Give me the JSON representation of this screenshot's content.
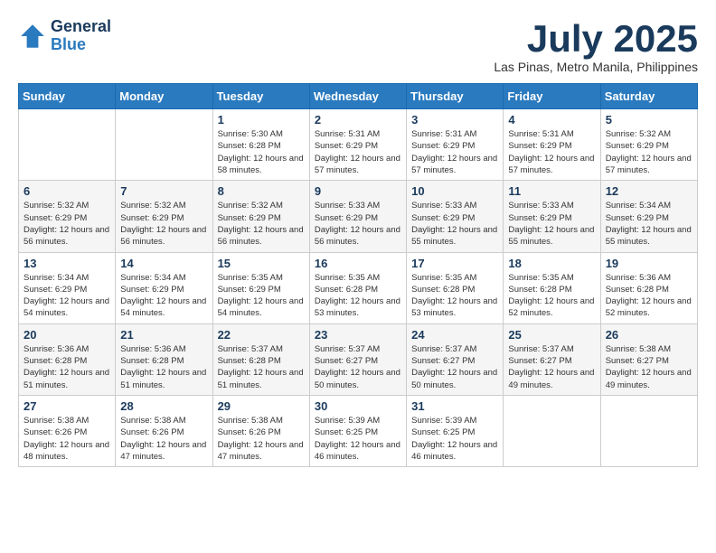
{
  "header": {
    "logo_line1": "General",
    "logo_line2": "Blue",
    "month_title": "July 2025",
    "location": "Las Pinas, Metro Manila, Philippines"
  },
  "days_of_week": [
    "Sunday",
    "Monday",
    "Tuesday",
    "Wednesday",
    "Thursday",
    "Friday",
    "Saturday"
  ],
  "weeks": [
    [
      {
        "day": "",
        "info": ""
      },
      {
        "day": "",
        "info": ""
      },
      {
        "day": "1",
        "info": "Sunrise: 5:30 AM\nSunset: 6:28 PM\nDaylight: 12 hours and 58 minutes."
      },
      {
        "day": "2",
        "info": "Sunrise: 5:31 AM\nSunset: 6:29 PM\nDaylight: 12 hours and 57 minutes."
      },
      {
        "day": "3",
        "info": "Sunrise: 5:31 AM\nSunset: 6:29 PM\nDaylight: 12 hours and 57 minutes."
      },
      {
        "day": "4",
        "info": "Sunrise: 5:31 AM\nSunset: 6:29 PM\nDaylight: 12 hours and 57 minutes."
      },
      {
        "day": "5",
        "info": "Sunrise: 5:32 AM\nSunset: 6:29 PM\nDaylight: 12 hours and 57 minutes."
      }
    ],
    [
      {
        "day": "6",
        "info": "Sunrise: 5:32 AM\nSunset: 6:29 PM\nDaylight: 12 hours and 56 minutes."
      },
      {
        "day": "7",
        "info": "Sunrise: 5:32 AM\nSunset: 6:29 PM\nDaylight: 12 hours and 56 minutes."
      },
      {
        "day": "8",
        "info": "Sunrise: 5:32 AM\nSunset: 6:29 PM\nDaylight: 12 hours and 56 minutes."
      },
      {
        "day": "9",
        "info": "Sunrise: 5:33 AM\nSunset: 6:29 PM\nDaylight: 12 hours and 56 minutes."
      },
      {
        "day": "10",
        "info": "Sunrise: 5:33 AM\nSunset: 6:29 PM\nDaylight: 12 hours and 55 minutes."
      },
      {
        "day": "11",
        "info": "Sunrise: 5:33 AM\nSunset: 6:29 PM\nDaylight: 12 hours and 55 minutes."
      },
      {
        "day": "12",
        "info": "Sunrise: 5:34 AM\nSunset: 6:29 PM\nDaylight: 12 hours and 55 minutes."
      }
    ],
    [
      {
        "day": "13",
        "info": "Sunrise: 5:34 AM\nSunset: 6:29 PM\nDaylight: 12 hours and 54 minutes."
      },
      {
        "day": "14",
        "info": "Sunrise: 5:34 AM\nSunset: 6:29 PM\nDaylight: 12 hours and 54 minutes."
      },
      {
        "day": "15",
        "info": "Sunrise: 5:35 AM\nSunset: 6:29 PM\nDaylight: 12 hours and 54 minutes."
      },
      {
        "day": "16",
        "info": "Sunrise: 5:35 AM\nSunset: 6:28 PM\nDaylight: 12 hours and 53 minutes."
      },
      {
        "day": "17",
        "info": "Sunrise: 5:35 AM\nSunset: 6:28 PM\nDaylight: 12 hours and 53 minutes."
      },
      {
        "day": "18",
        "info": "Sunrise: 5:35 AM\nSunset: 6:28 PM\nDaylight: 12 hours and 52 minutes."
      },
      {
        "day": "19",
        "info": "Sunrise: 5:36 AM\nSunset: 6:28 PM\nDaylight: 12 hours and 52 minutes."
      }
    ],
    [
      {
        "day": "20",
        "info": "Sunrise: 5:36 AM\nSunset: 6:28 PM\nDaylight: 12 hours and 51 minutes."
      },
      {
        "day": "21",
        "info": "Sunrise: 5:36 AM\nSunset: 6:28 PM\nDaylight: 12 hours and 51 minutes."
      },
      {
        "day": "22",
        "info": "Sunrise: 5:37 AM\nSunset: 6:28 PM\nDaylight: 12 hours and 51 minutes."
      },
      {
        "day": "23",
        "info": "Sunrise: 5:37 AM\nSunset: 6:27 PM\nDaylight: 12 hours and 50 minutes."
      },
      {
        "day": "24",
        "info": "Sunrise: 5:37 AM\nSunset: 6:27 PM\nDaylight: 12 hours and 50 minutes."
      },
      {
        "day": "25",
        "info": "Sunrise: 5:37 AM\nSunset: 6:27 PM\nDaylight: 12 hours and 49 minutes."
      },
      {
        "day": "26",
        "info": "Sunrise: 5:38 AM\nSunset: 6:27 PM\nDaylight: 12 hours and 49 minutes."
      }
    ],
    [
      {
        "day": "27",
        "info": "Sunrise: 5:38 AM\nSunset: 6:26 PM\nDaylight: 12 hours and 48 minutes."
      },
      {
        "day": "28",
        "info": "Sunrise: 5:38 AM\nSunset: 6:26 PM\nDaylight: 12 hours and 47 minutes."
      },
      {
        "day": "29",
        "info": "Sunrise: 5:38 AM\nSunset: 6:26 PM\nDaylight: 12 hours and 47 minutes."
      },
      {
        "day": "30",
        "info": "Sunrise: 5:39 AM\nSunset: 6:25 PM\nDaylight: 12 hours and 46 minutes."
      },
      {
        "day": "31",
        "info": "Sunrise: 5:39 AM\nSunset: 6:25 PM\nDaylight: 12 hours and 46 minutes."
      },
      {
        "day": "",
        "info": ""
      },
      {
        "day": "",
        "info": ""
      }
    ]
  ]
}
